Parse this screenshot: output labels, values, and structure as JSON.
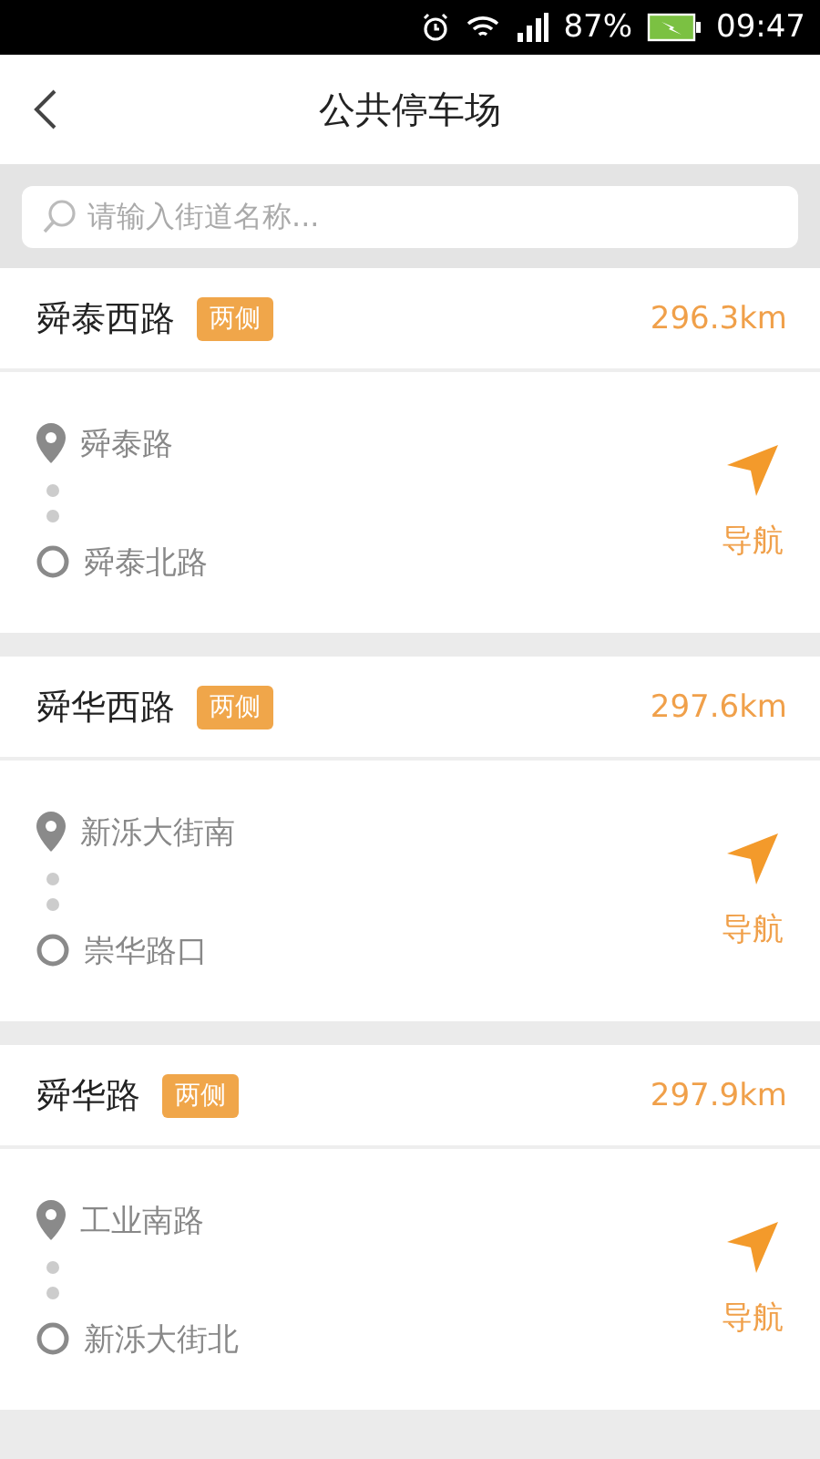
{
  "status_bar": {
    "battery": "87%",
    "time": "09:47"
  },
  "header": {
    "title": "公共停车场"
  },
  "search": {
    "placeholder": "请输入街道名称..."
  },
  "lots": [
    {
      "name": "舜泰西路",
      "tag": "两侧",
      "distance": "296.3km",
      "start": "舜泰路",
      "end": "舜泰北路",
      "action": "导航"
    },
    {
      "name": "舜华西路",
      "tag": "两侧",
      "distance": "297.6km",
      "start": "新泺大街南",
      "end": "崇华路口",
      "action": "导航"
    },
    {
      "name": "舜华路",
      "tag": "两侧",
      "distance": "297.9km",
      "start": "工业南路",
      "end": "新泺大街北",
      "action": "导航"
    }
  ]
}
